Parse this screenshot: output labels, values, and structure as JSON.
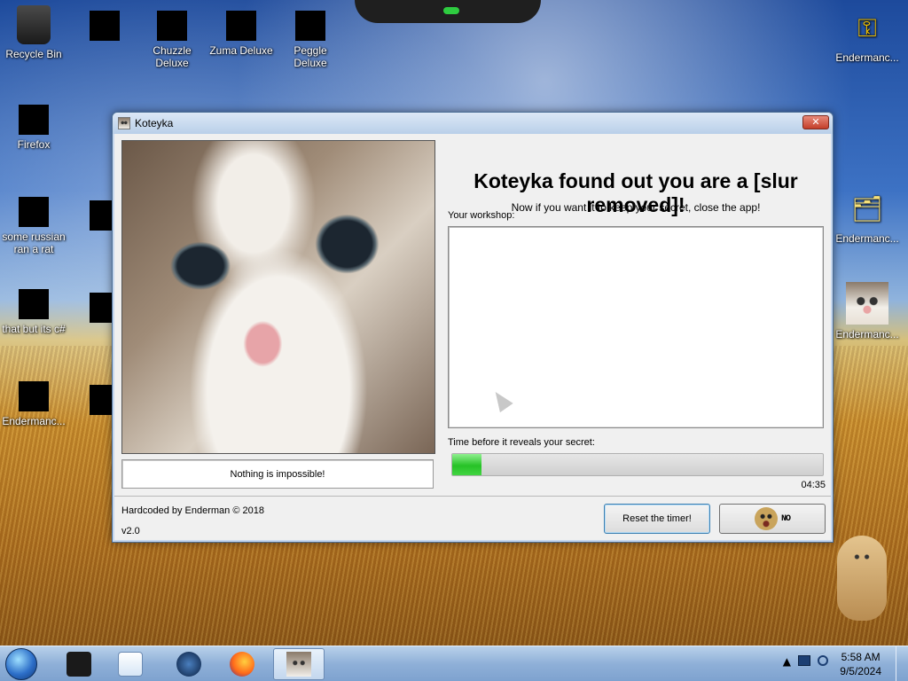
{
  "desktop": {
    "icons_left": [
      {
        "label": "Recycle Bin",
        "icon": "recycle-bin-icon"
      },
      {
        "label": "Chuzzle Deluxe",
        "icon": "chuzzle-icon"
      },
      {
        "label": "Zuma Deluxe",
        "icon": "zuma-icon"
      },
      {
        "label": "Peggle Deluxe",
        "icon": "peggle-icon"
      },
      {
        "label": "Firefox",
        "icon": "firefox-icon"
      },
      {
        "label": "some russian ran a rat",
        "icon": "app-icon"
      },
      {
        "label": "that but its c#",
        "icon": "app-icon"
      },
      {
        "label": "Endermanc...",
        "icon": "app-icon"
      }
    ],
    "icons_right": [
      {
        "label": "Endermanc...",
        "icon": "key-icon"
      },
      {
        "label": "Endermanc...",
        "icon": "documents-icon"
      },
      {
        "label": "Endermanc...",
        "icon": "cat-image-icon"
      }
    ]
  },
  "window": {
    "title": "Koteyka",
    "close_symbol": "✕",
    "heading": "Koteyka found out you are a [slur removed]!",
    "subheading": "Now if you want it to keep your secret, close the app!",
    "caption": "Nothing is impossible!",
    "workshop_label": "Your workshop:",
    "timer_label": "Time before it reveals your secret:",
    "progress_fraction": 0.08,
    "timer_value": "04:35",
    "credit": "Hardcoded by Enderman © 2018",
    "version": "v2.0",
    "reset_button": "Reset the timer!",
    "no_button_text": "NO"
  },
  "taskbar": {
    "clock_time": "5:58 AM",
    "clock_date": "9/5/2024",
    "tray_arrow": "▲"
  },
  "colors": {
    "progress_green": "#27c227",
    "close_red": "#c33e2a"
  }
}
